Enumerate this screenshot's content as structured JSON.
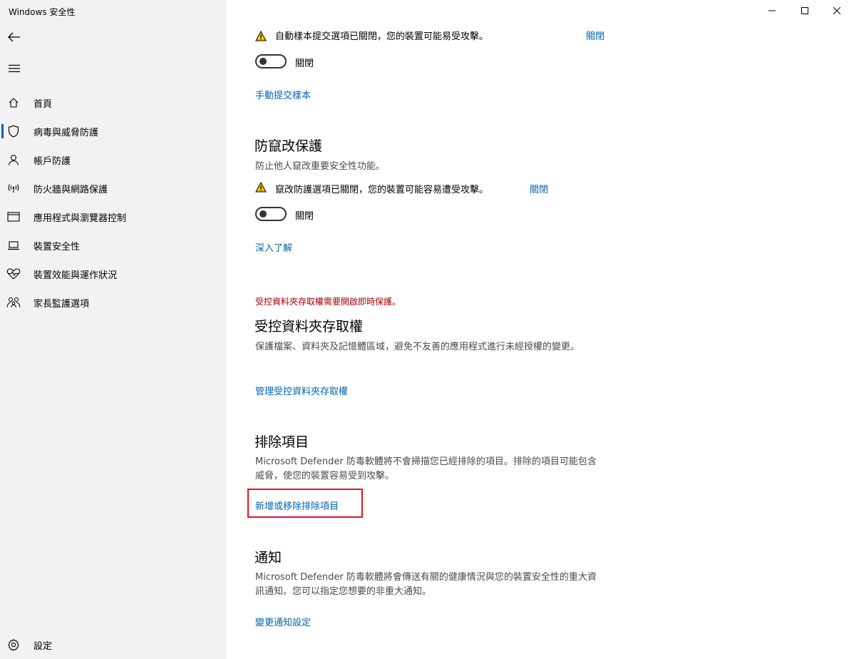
{
  "window": {
    "title": "Windows 安全性"
  },
  "sidebar": {
    "items": [
      {
        "label": "首頁",
        "icon": "home-icon"
      },
      {
        "label": "病毒與威脅防護",
        "icon": "shield-icon"
      },
      {
        "label": "帳戶防護",
        "icon": "person-icon"
      },
      {
        "label": "防火牆與網路保護",
        "icon": "wireless-icon"
      },
      {
        "label": "應用程式與瀏覽器控制",
        "icon": "app-window-icon"
      },
      {
        "label": "裝置安全性",
        "icon": "laptop-icon"
      },
      {
        "label": "裝置效能與運作狀況",
        "icon": "heart-pulse-icon"
      },
      {
        "label": "家長監護選項",
        "icon": "family-icon"
      }
    ],
    "active_index": 1,
    "settings_label": "設定"
  },
  "sample_submission": {
    "warning_text": "自動樣本提交選項已關閉，您的裝置可能易受攻擊。",
    "dismiss_label": "關閉",
    "toggle_label": "關閉",
    "toggle_on": false,
    "link_label": "手動提交樣本"
  },
  "tamper_protection": {
    "heading": "防竄改保護",
    "description": "防止他人竄改重要安全性功能。",
    "warning_text": "竄改防護選項已關閉，您的裝置可能容易遭受攻擊。",
    "dismiss_label": "關閉",
    "toggle_label": "關閉",
    "toggle_on": false,
    "link_label": "深入了解"
  },
  "controlled_folder": {
    "error_text": "受控資料夾存取權需要開啟即時保護。",
    "heading": "受控資料夾存取權",
    "description": "保護檔案、資料夾及記憶體區域，避免不友善的應用程式進行未經授權的變更。",
    "link_label": "管理受控資料夾存取權"
  },
  "exclusions": {
    "heading": "排除項目",
    "description": "Microsoft Defender 防毒軟體將不會掃描您已經排除的項目。排除的項目可能包含威脅，使您的裝置容易受到攻擊。",
    "link_label": "新增或移除排除項目"
  },
  "notifications": {
    "heading": "通知",
    "description": "Microsoft Defender 防毒軟體將會傳送有關的健康情況與您的裝置安全性的重大資訊通知。您可以指定您想要的非重大通知。",
    "link_label": "變更通知設定"
  },
  "colors": {
    "accent": "#0063b1",
    "sidebar_bg": "#f2f2f2",
    "error": "#a80000",
    "highlight": "#e81123",
    "warning": "#f8c300"
  }
}
